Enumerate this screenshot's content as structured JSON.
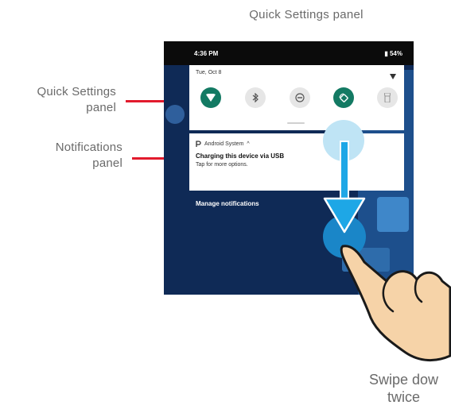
{
  "figure": {
    "title": "Quick Settings panel"
  },
  "callouts": {
    "quick_settings": [
      "Quick Settings",
      "panel"
    ],
    "notifications": [
      "Notifications",
      "panel"
    ]
  },
  "device": {
    "status_time": "4:36 PM",
    "status_battery": "54%",
    "date": "Tue, Oct 8",
    "tiles": [
      {
        "icon": "wifi-icon",
        "state": "on"
      },
      {
        "icon": "bluetooth-icon",
        "state": "off"
      },
      {
        "icon": "do-not-disturb-icon",
        "state": "off"
      },
      {
        "icon": "auto-rotate-icon",
        "state": "on"
      },
      {
        "icon": "flashlight-icon",
        "state": "off"
      }
    ],
    "notification": {
      "app": "Android System",
      "title": "Charging this device via USB",
      "text": "Tap for more options."
    },
    "manage_label": "Manage notifications"
  },
  "gesture": {
    "caption": [
      "Swipe dow",
      "twice"
    ]
  },
  "colors": {
    "leader_line": "#e21b2d",
    "tile_active": "#137a63",
    "arrow": "#1ea7e6",
    "touch_circle_start": "#bfe4f5",
    "touch_circle_end": "#1a86c8",
    "hand_fill": "#f6d3a8",
    "hand_outline": "#1a1a1a"
  }
}
